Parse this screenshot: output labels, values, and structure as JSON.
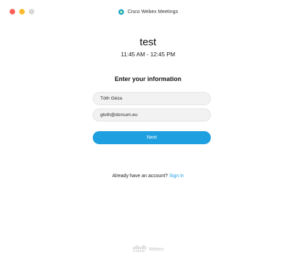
{
  "window": {
    "app_title": "Cisco Webex Meetings",
    "logo_icon": "webex-logo-icon"
  },
  "meeting": {
    "title": "test",
    "time": "11:45 AM - 12:45 PM"
  },
  "form": {
    "heading": "Enter your information",
    "name_value": "Tóth Géza",
    "email_value": "gtoth@dorsum.eu",
    "next_label": "Next"
  },
  "account": {
    "prompt": "Already have an account?",
    "sign_in_label": "Sign in"
  },
  "footer": {
    "cisco_label": "CISCO",
    "webex_label": "Webex"
  },
  "colors": {
    "accent": "#1e9fe0",
    "close": "#fc5f57",
    "minimize": "#fdbb2d",
    "maximize": "#d8d8d8"
  }
}
